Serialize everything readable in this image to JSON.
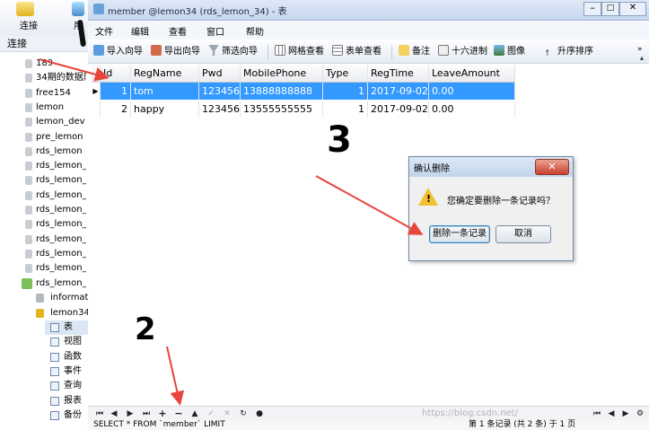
{
  "left_panel": {
    "toolbar": {
      "connect_label": "连接",
      "user_label": "用"
    },
    "section_label": "连接",
    "tree_items": [
      "189",
      "34期的数据库",
      "free154",
      "lemon",
      "lemon_dev",
      "pre_lemon",
      "rds_lemon",
      "rds_lemon_",
      "rds_lemon_",
      "rds_lemon_",
      "rds_lemon_",
      "rds_lemon_",
      "rds_lemon_",
      "rds_lemon_",
      "rds_lemon_"
    ],
    "expanded_connection": "rds_lemon_",
    "schema_items": [
      {
        "label": "informat",
        "icon": "database-icon"
      },
      {
        "label": "lemon34",
        "icon": "database-icon"
      }
    ],
    "object_items": [
      {
        "label": "表",
        "icon": "table-icon"
      },
      {
        "label": "视图",
        "icon": "view-icon"
      },
      {
        "label": "函数",
        "icon": "function-icon"
      },
      {
        "label": "事件",
        "icon": "event-icon"
      },
      {
        "label": "查询",
        "icon": "query-icon"
      },
      {
        "label": "报表",
        "icon": "report-icon"
      },
      {
        "label": "备份",
        "icon": "backup-icon"
      }
    ]
  },
  "window": {
    "title": "member @lemon34 (rds_lemon_34) - 表",
    "menu": [
      "文件",
      "编辑",
      "查看",
      "窗口",
      "帮助"
    ],
    "toolbar": [
      {
        "label": "导入向导",
        "icon": "import-icon"
      },
      {
        "label": "导出向导",
        "icon": "export-icon"
      },
      {
        "label": "筛选向导",
        "icon": "filter-icon"
      },
      {
        "label": "网格查看",
        "icon": "grid-icon"
      },
      {
        "label": "表单查看",
        "icon": "form-icon"
      },
      {
        "label": "备注",
        "icon": "memo-icon"
      },
      {
        "label": "十六进制",
        "icon": "hex-icon"
      },
      {
        "label": "图像",
        "icon": "image-icon"
      },
      {
        "label": "升序排序",
        "icon": "sort-asc-icon"
      }
    ]
  },
  "table": {
    "columns": [
      "Id",
      "RegName",
      "Pwd",
      "MobilePhone",
      "Type",
      "RegTime",
      "LeaveAmount"
    ],
    "rows": [
      [
        "1",
        "tom",
        "123456",
        "13888888888",
        "1",
        "2017-09-02",
        "0.00"
      ],
      [
        "2",
        "happy",
        "123456",
        "13555555555",
        "1",
        "2017-09-02",
        "0.00"
      ]
    ],
    "selected_row": 0
  },
  "dialog": {
    "title": "确认删除",
    "message": "您确定要删除一条记录吗？",
    "confirm_label": "删除一条记录",
    "cancel_label": "取消",
    "close_label": "✕"
  },
  "annotations": {
    "mark_1": "1",
    "mark_2": "2",
    "mark_3": "3",
    "color": "#e8453c"
  },
  "bottom_nav": {
    "buttons": [
      "first",
      "prev",
      "next",
      "last",
      "add",
      "delete",
      "up",
      "check",
      "cancel",
      "refresh",
      "stop"
    ]
  },
  "status": {
    "sql": "SELECT * FROM `member` LIMIT ",
    "record_info": "第 1 条记录 (共 2 条) 于 1 页",
    "watermark": "https://blog.csdn.net/"
  }
}
